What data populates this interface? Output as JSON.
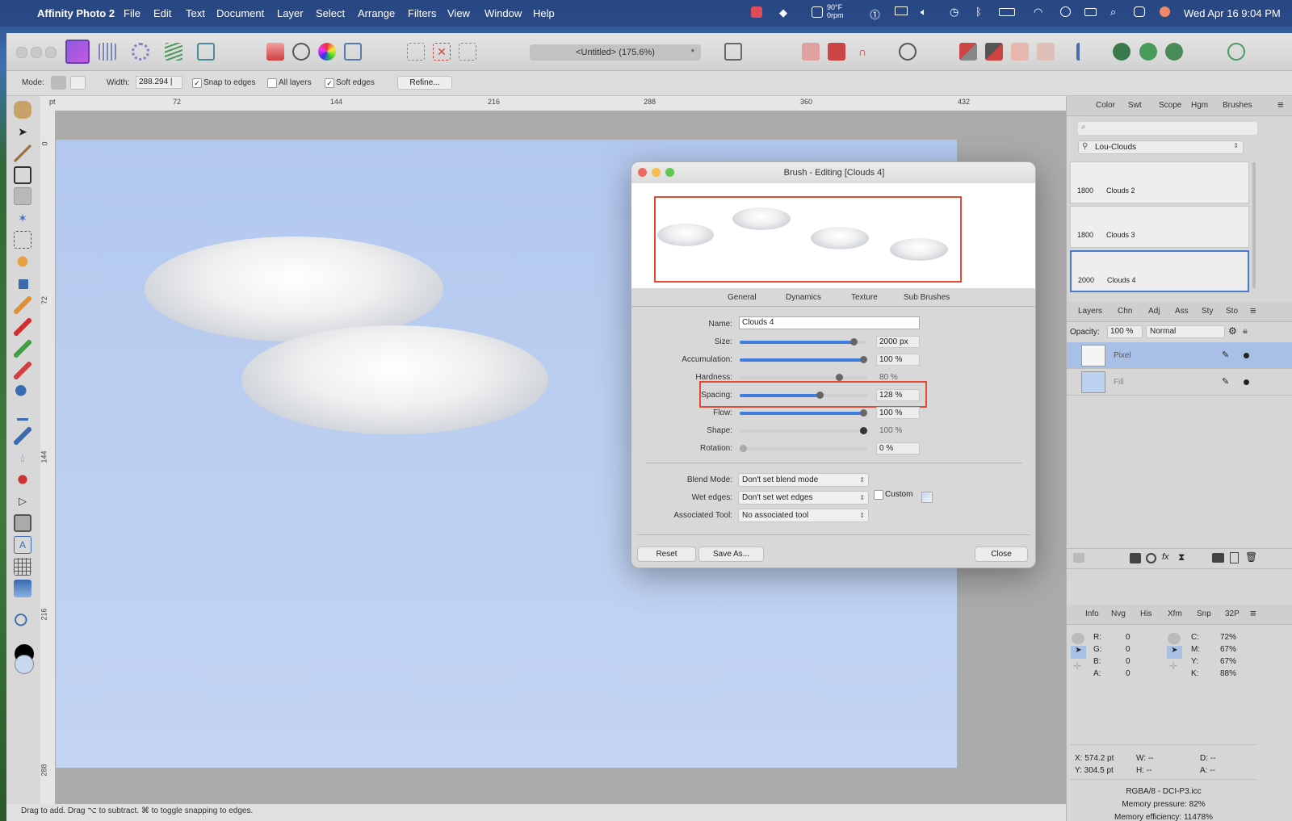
{
  "menubar": {
    "app": "Affinity Photo 2",
    "items": [
      "File",
      "Edit",
      "Text",
      "Document",
      "Layer",
      "Select",
      "Arrange",
      "Filters",
      "View",
      "Window",
      "Help"
    ],
    "weather_temp": "90°F",
    "weather_sub": "0rpm",
    "datetime": "Wed Apr 16  9:04 PM"
  },
  "window": {
    "doc_title": "<Untitled> (175.6%)",
    "doc_modified": "*"
  },
  "context_toolbar": {
    "mode_label": "Mode:",
    "width_label": "Width:",
    "width_value": "288.294 |",
    "snap_label": "Snap to edges",
    "all_layers_label": "All layers",
    "soft_edges_label": "Soft edges",
    "refine_label": "Refine..."
  },
  "ruler": {
    "unit": "pt",
    "h_ticks": [
      "72",
      "144",
      "216",
      "288",
      "360",
      "432"
    ],
    "v_ticks": [
      "0",
      "72",
      "144",
      "216",
      "288"
    ]
  },
  "status_bar": {
    "text": "Drag to add. Drag ⌥ to subtract. ⌘ to toggle snapping to edges."
  },
  "brushes_panel": {
    "tabs": [
      "Color",
      "Swt",
      "Scope",
      "Hgm",
      "Brushes"
    ],
    "category": "Lou-Clouds",
    "brushes": [
      {
        "size": "1800",
        "name": "Clouds 2"
      },
      {
        "size": "1800",
        "name": "Clouds 3"
      },
      {
        "size": "2000",
        "name": "Clouds 4"
      }
    ]
  },
  "layers_panel": {
    "tabs": [
      "Layers",
      "Chn",
      "Adj",
      "Ass",
      "Sty",
      "Sto"
    ],
    "opacity_label": "Opacity:",
    "opacity_value": "100 %",
    "blend_mode": "Normal",
    "layers": [
      {
        "name": "Pixel",
        "selected": true
      },
      {
        "name": "Fill",
        "selected": false
      }
    ]
  },
  "info_panel": {
    "tabs": [
      "Info",
      "Nvg",
      "His",
      "Xfm",
      "Snp",
      "32P"
    ],
    "rgba": [
      {
        "k": "R:",
        "v": "0"
      },
      {
        "k": "G:",
        "v": "0"
      },
      {
        "k": "B:",
        "v": "0"
      },
      {
        "k": "A:",
        "v": "0"
      }
    ],
    "cmyk": [
      {
        "k": "C:",
        "v": "72%"
      },
      {
        "k": "M:",
        "v": "67%"
      },
      {
        "k": "Y:",
        "v": "67%"
      },
      {
        "k": "K:",
        "v": "88%"
      }
    ],
    "x": "X: 574.2 pt",
    "y": "Y: 304.5 pt",
    "w": "W: --",
    "h": "H: --",
    "d": "D: --",
    "a": "A: --",
    "format": "RGBA/8 - DCI-P3.icc",
    "memory_pressure": "Memory pressure: 82%",
    "memory_efficiency": "Memory efficiency: 11478%"
  },
  "dialog": {
    "title": "Brush - Editing [Clouds 4]",
    "tabs": [
      "General",
      "Dynamics",
      "Texture",
      "Sub Brushes"
    ],
    "name_label": "Name:",
    "name_value": "Clouds 4",
    "params": [
      {
        "label": "Size:",
        "value": "2000 px",
        "level": 0.92
      },
      {
        "label": "Accumulation:",
        "value": "100 %",
        "level": 1.0
      },
      {
        "label": "Hardness:",
        "value": "80 %",
        "level": 0.8
      },
      {
        "label": "Spacing:",
        "value": "128 %",
        "level": 0.64
      },
      {
        "label": "Flow:",
        "value": "100 %",
        "level": 1.0
      },
      {
        "label": "Shape:",
        "value": "100 %",
        "level": 1.0
      },
      {
        "label": "Rotation:",
        "value": "0 %",
        "level": 0.0
      }
    ],
    "blend_mode_label": "Blend Mode:",
    "blend_mode_value": "Don't set blend mode",
    "wet_edges_label": "Wet edges:",
    "wet_edges_value": "Don't set wet edges",
    "custom_label": "Custom",
    "associated_tool_label": "Associated Tool:",
    "associated_tool_value": "No associated tool",
    "reset_label": "Reset",
    "save_as_label": "Save As...",
    "close_label": "Close"
  },
  "colors": {
    "highlight": "#e24a33",
    "slider_fill": "#3f7ce0",
    "selected_layer": "#a9c0e6"
  }
}
